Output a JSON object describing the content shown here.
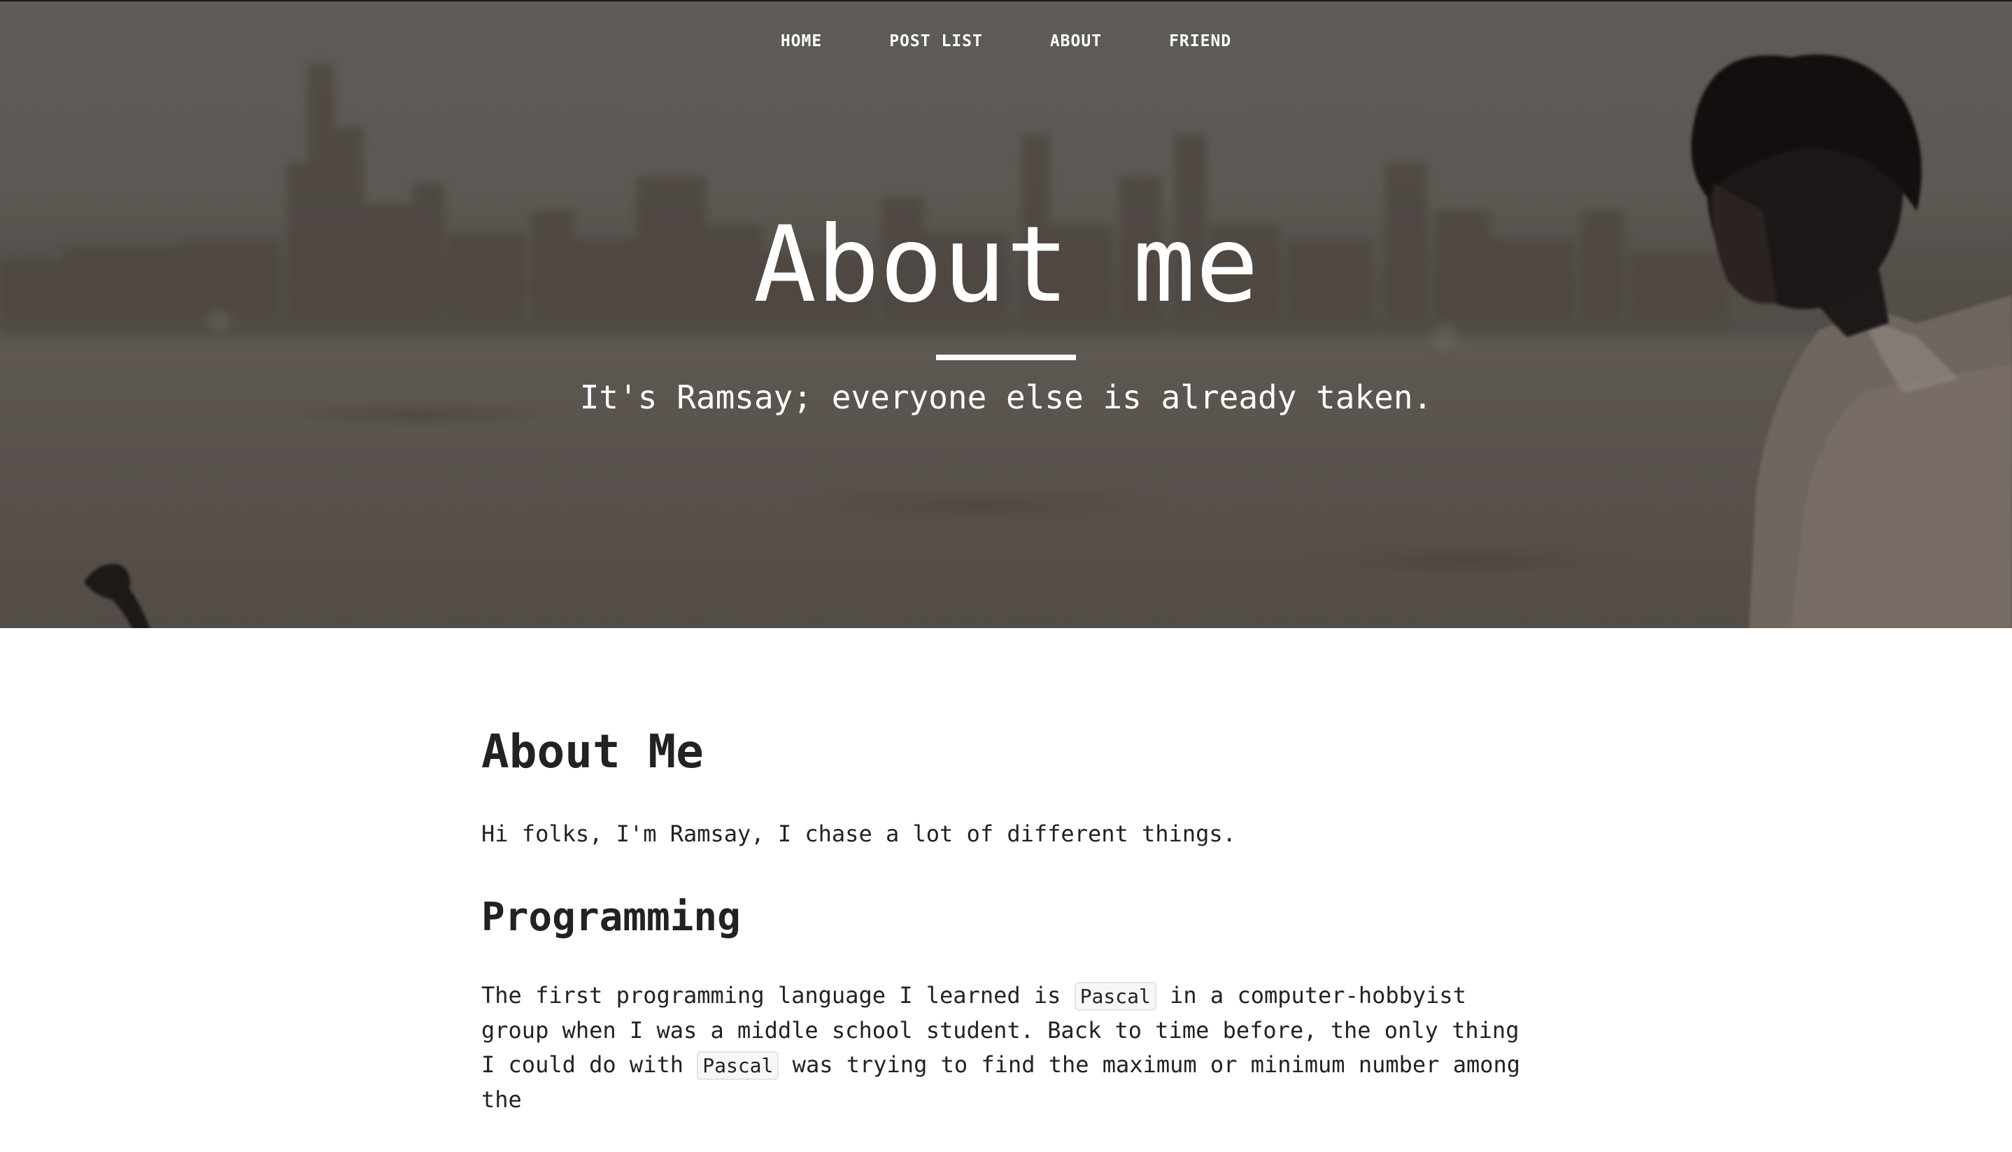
{
  "nav": {
    "items": [
      {
        "label": "HOME"
      },
      {
        "label": "POST LIST"
      },
      {
        "label": "ABOUT"
      },
      {
        "label": "FRIEND"
      }
    ]
  },
  "hero": {
    "title": "About me",
    "subtitle": "It's Ramsay; everyone else is already taken."
  },
  "article": {
    "heading": "About Me",
    "intro": "Hi folks, I'm Ramsay, I chase a lot of different things.",
    "section_heading": "Programming",
    "para_part1": "The first programming language I learned is",
    "code1": "Pascal",
    "para_part2": "in a computer-hobbyist group when I was a middle school student. Back to time before, the only thing I could do with",
    "code2": "Pascal",
    "para_part3": "was trying to find the maximum or minimum number among the"
  },
  "colors": {
    "text": "#222222",
    "hero_text": "#ffffff"
  }
}
